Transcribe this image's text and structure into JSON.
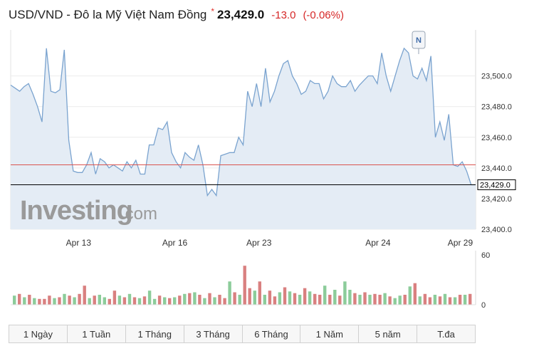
{
  "header": {
    "pair": "USD/VND - Đô la Mỹ Việt Nam Đồng",
    "star": "*",
    "price": "23,429.0",
    "change": "-13.0",
    "change_pct": "(-0.06%)"
  },
  "watermark": {
    "main": "Investing",
    "suffix": ".com"
  },
  "news_marker": "N",
  "colors": {
    "line": "#7aa3cf",
    "area": "#e4ecf5",
    "ref_line": "#d9534f",
    "up": "#8ccc9a",
    "down": "#d98080"
  },
  "chart_data": {
    "type": "area",
    "title": "",
    "x_tick_labels": [
      "Apr 13",
      "Apr 16",
      "Apr 23",
      "Apr 24",
      "Apr 29"
    ],
    "ylim": [
      23400,
      23530
    ],
    "y_ticks": [
      "23,400.0",
      "23,420.0",
      "23,440.0",
      "23,460.0",
      "23,480.0",
      "23,500.0"
    ],
    "y_tick_values": [
      23400,
      23420,
      23440,
      23460,
      23480,
      23500
    ],
    "previous_close": 23442,
    "current_value": 23429,
    "current_label": "23,429.0",
    "values": [
      23494,
      23492,
      23490,
      23493,
      23495,
      23488,
      23480,
      23470,
      23518,
      23490,
      23489,
      23491,
      23517,
      23458,
      23438,
      23437,
      23437,
      23442,
      23450,
      23436,
      23446,
      23444,
      23440,
      23442,
      23440,
      23438,
      23444,
      23440,
      23445,
      23436,
      23436,
      23455,
      23455,
      23466,
      23465,
      23470,
      23450,
      23444,
      23440,
      23450,
      23447,
      23445,
      23455,
      23442,
      23422,
      23426,
      23422,
      23448,
      23449,
      23450,
      23450,
      23460,
      23455,
      23490,
      23480,
      23495,
      23480,
      23505,
      23483,
      23490,
      23500,
      23508,
      23510,
      23500,
      23495,
      23488,
      23490,
      23497,
      23495,
      23495,
      23485,
      23490,
      23500,
      23495,
      23493,
      23493,
      23497,
      23490,
      23494,
      23497,
      23500,
      23500,
      23495,
      23515,
      23500,
      23490,
      23500,
      23510,
      23518,
      23515,
      23500,
      23498,
      23505,
      23497,
      23513,
      23460,
      23470,
      23458,
      23475,
      23442,
      23441,
      23444,
      23438,
      23429,
      23429
    ],
    "volume_ylim": [
      0,
      60
    ],
    "volume_ticks": [
      0,
      60
    ],
    "volume": [
      11,
      13,
      9,
      12,
      8,
      7,
      7,
      11,
      8,
      9,
      13,
      11,
      9,
      13,
      23,
      8,
      11,
      12,
      9,
      7,
      17,
      11,
      9,
      13,
      9,
      8,
      10,
      17,
      7,
      11,
      9,
      8,
      9,
      11,
      13,
      14,
      15,
      12,
      8,
      14,
      9,
      12,
      8,
      28,
      15,
      12,
      47,
      20,
      17,
      28,
      12,
      17,
      10,
      15,
      21,
      16,
      14,
      12,
      20,
      16,
      13,
      12,
      23,
      12,
      18,
      11,
      28,
      18,
      14,
      12,
      15,
      12,
      13,
      12,
      14,
      10,
      8,
      11,
      12,
      22,
      26,
      10,
      13,
      9,
      12,
      10,
      13,
      9,
      9,
      12,
      12,
      13
    ],
    "volume_direction": [
      "u",
      "d",
      "u",
      "d",
      "u",
      "d",
      "d",
      "d",
      "u",
      "d",
      "u",
      "d",
      "u",
      "d",
      "d",
      "u",
      "d",
      "u",
      "u",
      "d",
      "d",
      "u",
      "d",
      "u",
      "d",
      "u",
      "d",
      "u",
      "u",
      "d",
      "u",
      "d",
      "u",
      "d",
      "u",
      "d",
      "u",
      "d",
      "u",
      "d",
      "u",
      "d",
      "d",
      "u",
      "d",
      "u",
      "d",
      "d",
      "u",
      "d",
      "u",
      "d",
      "d",
      "u",
      "d",
      "u",
      "d",
      "u",
      "d",
      "u",
      "d",
      "d",
      "u",
      "d",
      "u",
      "d",
      "u",
      "u",
      "d",
      "u",
      "d",
      "u",
      "d",
      "d",
      "u",
      "d",
      "u",
      "u",
      "d",
      "u",
      "d",
      "u",
      "d",
      "d",
      "u",
      "d",
      "u",
      "d",
      "u",
      "d",
      "u",
      "d"
    ]
  },
  "timeframes": [
    "1 Ngày",
    "1 Tuần",
    "1 Tháng",
    "3 Tháng",
    "6 Tháng",
    "1 Năm",
    "5 năm",
    "T.đa"
  ]
}
